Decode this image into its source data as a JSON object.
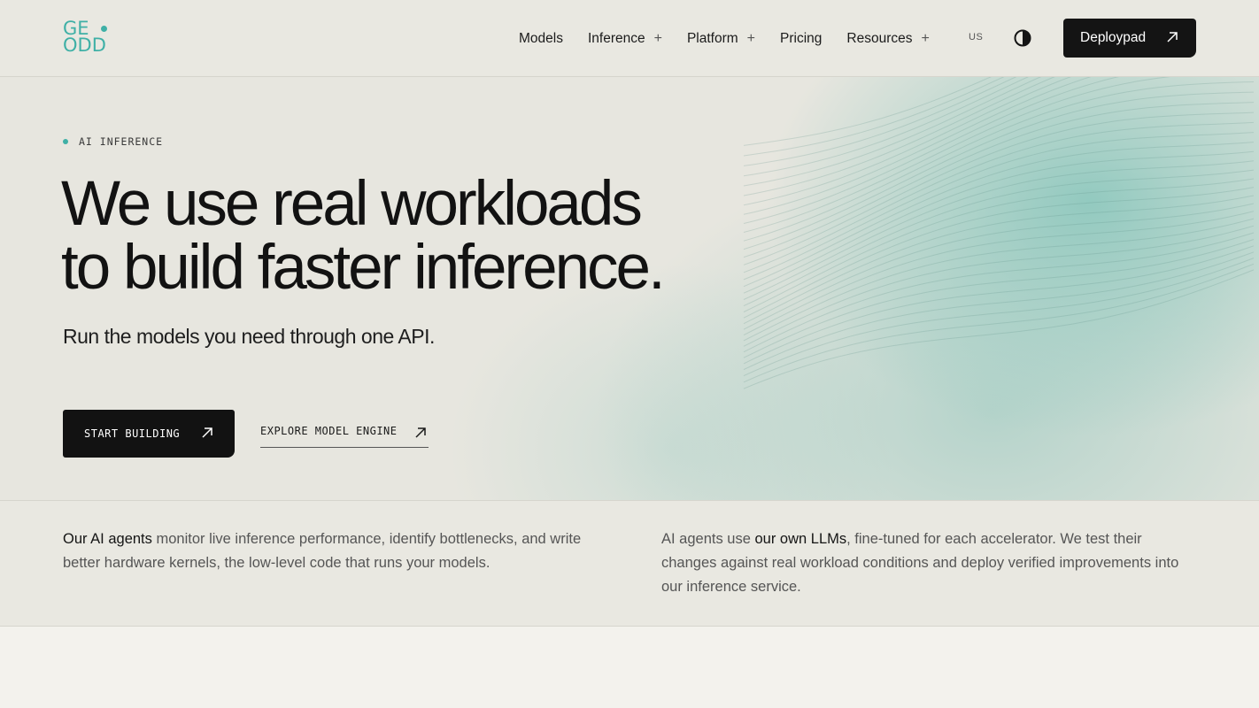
{
  "brand": {
    "logo_line1": "GE",
    "logo_line2": "ODD",
    "accent_color": "#3fb0a6"
  },
  "nav": {
    "items": [
      {
        "label": "Models",
        "has_menu": false
      },
      {
        "label": "Inference",
        "has_menu": true
      },
      {
        "label": "Platform",
        "has_menu": true
      },
      {
        "label": "Pricing",
        "has_menu": false
      },
      {
        "label": "Resources",
        "has_menu": true
      }
    ],
    "menu_icon": "plus-icon",
    "region": "US",
    "theme_icon": "contrast-icon",
    "cta_label": "Deploypad",
    "cta_icon": "arrow-up-right-icon"
  },
  "hero": {
    "eyebrow": "AI INFERENCE",
    "headline_line1": "We use real workloads",
    "headline_line2": "to build faster inference.",
    "subhead": "Run the models you need through one API.",
    "primary_label": "START BUILDING",
    "secondary_label": "EXPLORE MODEL ENGINE"
  },
  "info": {
    "left_strong": "Our AI agents",
    "left_rest": " monitor live inference performance, identify bottlenecks, and write better hardware kernels, the low-level code that runs your models.",
    "right_pre": "AI agents use ",
    "right_strong": "our own LLMs",
    "right_rest": ", fine-tuned for each accelerator. We test their changes against real workload conditions and deploy verified improvements into our inference service."
  }
}
